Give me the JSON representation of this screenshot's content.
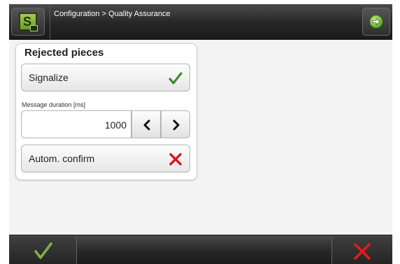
{
  "header": {
    "app_icon": "s-logo-icon",
    "breadcrumb": "Configuration > Quality Assurance",
    "next_icon": "arrow-right-circle-icon"
  },
  "panel": {
    "title": "Rejected pieces",
    "signalize": {
      "label": "Signalize",
      "state": "on",
      "state_icon": "checkmark-icon"
    },
    "message_duration": {
      "label": "Message duration [ms]",
      "value": "1000",
      "decrement_icon": "chevron-left-icon",
      "increment_icon": "chevron-right-icon"
    },
    "autom_confirm": {
      "label": "Autom. confirm",
      "state": "off",
      "state_icon": "cross-icon"
    }
  },
  "footer": {
    "ok_icon": "checkmark-icon",
    "cancel_icon": "cross-icon"
  },
  "colors": {
    "check": "#2e8b1e",
    "cross": "#d81616",
    "accent": "#7fb33a"
  }
}
